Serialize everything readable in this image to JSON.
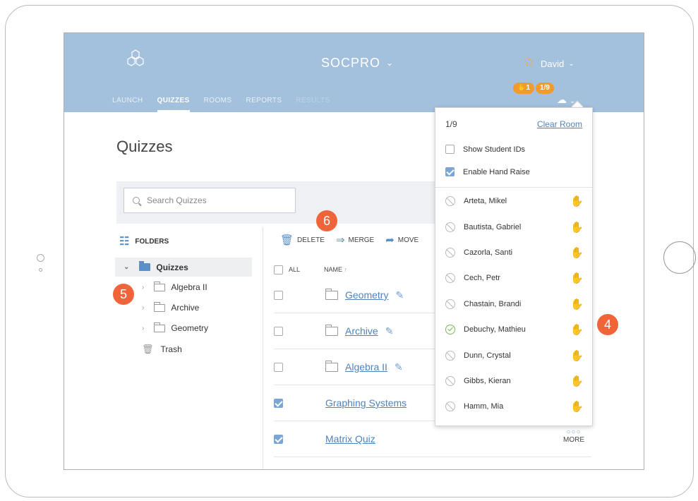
{
  "header": {
    "app_title": "SOCPRO",
    "user_name": "David",
    "nav": [
      "LAUNCH",
      "QUIZZES",
      "ROOMS",
      "REPORTS",
      "RESULTS"
    ],
    "badges": {
      "hand_count": "1",
      "room_count": "1/9"
    }
  },
  "page": {
    "title": "Quizzes",
    "search_placeholder": "Search Quizzes"
  },
  "sidebar": {
    "heading": "FOLDERS",
    "root": "Quizzes",
    "children": [
      "Algebra II",
      "Archive",
      "Geometry"
    ],
    "trash": "Trash"
  },
  "toolbar": {
    "delete": "DELETE",
    "merge": "MERGE",
    "move": "MOVE"
  },
  "list": {
    "all_label": "ALL",
    "name_label": "NAME",
    "rows": [
      {
        "name": "Geometry",
        "type": "folder",
        "checked": false
      },
      {
        "name": "Archive",
        "type": "folder",
        "checked": false
      },
      {
        "name": "Algebra II",
        "type": "folder",
        "checked": false
      },
      {
        "name": "Graphing Systems",
        "type": "quiz",
        "checked": true
      },
      {
        "name": "Matrix Quiz",
        "type": "quiz",
        "checked": true
      }
    ],
    "more_label": "MORE"
  },
  "room_panel": {
    "count": "1/9",
    "clear_room": "Clear Room",
    "show_student_ids": "Show Student IDs",
    "enable_hand_raise": "Enable Hand Raise",
    "students": [
      {
        "name": "Arteta, Mikel",
        "status": "absent",
        "hand": false
      },
      {
        "name": "Bautista, Gabriel",
        "status": "absent",
        "hand": false
      },
      {
        "name": "Cazorla, Santi",
        "status": "absent",
        "hand": false
      },
      {
        "name": "Cech, Petr",
        "status": "absent",
        "hand": false
      },
      {
        "name": "Chastain, Brandi",
        "status": "absent",
        "hand": false
      },
      {
        "name": "Debuchy, Mathieu",
        "status": "present",
        "hand": true
      },
      {
        "name": "Dunn, Crystal",
        "status": "absent",
        "hand": false
      },
      {
        "name": "Gibbs, Kieran",
        "status": "absent",
        "hand": false
      },
      {
        "name": "Hamm, Mia",
        "status": "absent",
        "hand": false
      }
    ]
  },
  "callouts": [
    "4",
    "5",
    "6"
  ],
  "colors": {
    "header_bg": "#a3c0dc",
    "accent": "#5a8fc7",
    "link": "#4f83bd",
    "badge": "#f39a2c",
    "callout": "#f0643a",
    "present": "#7ab55c"
  }
}
